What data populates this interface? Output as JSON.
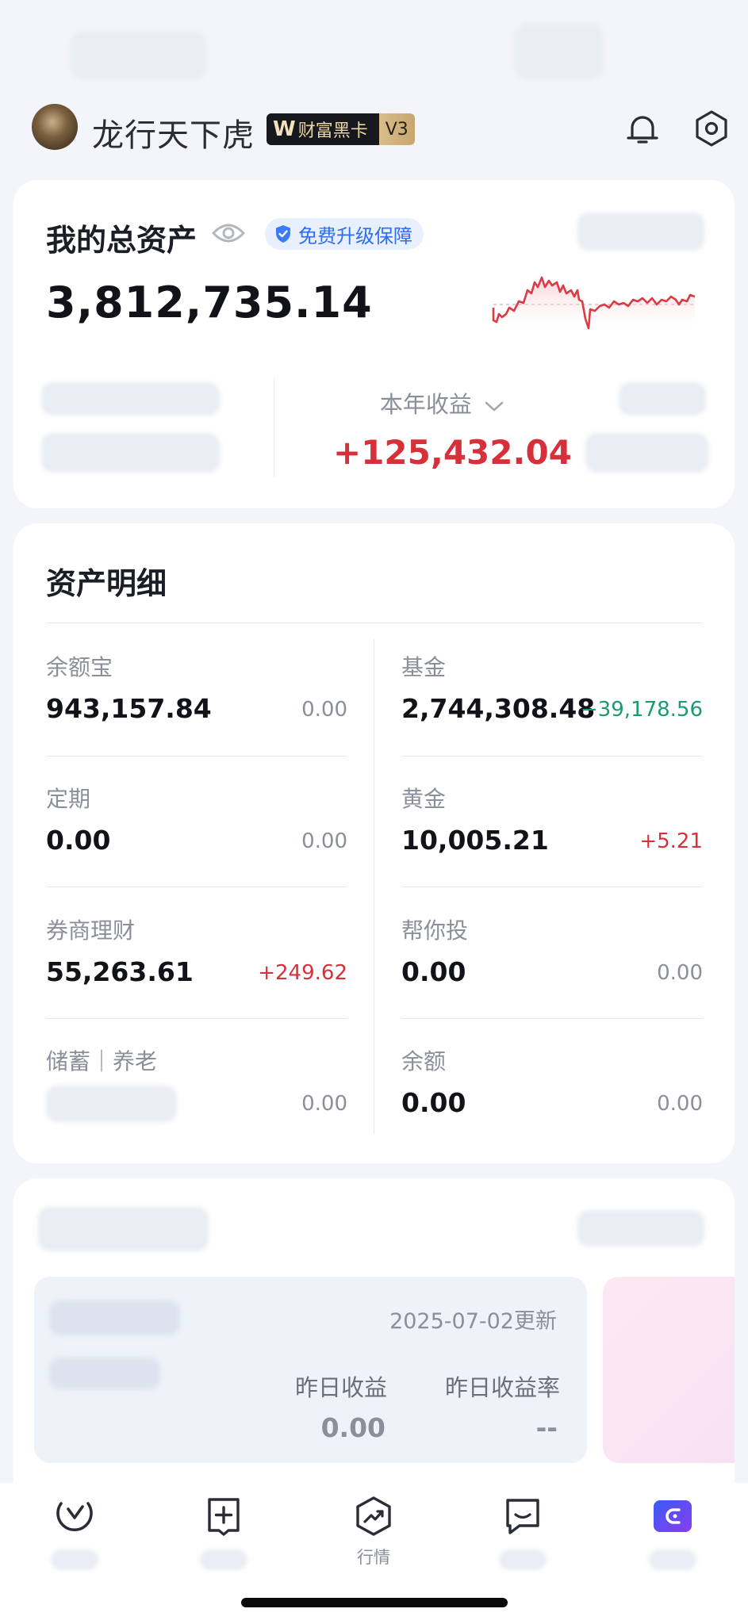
{
  "header": {
    "username": "龙行天下虎",
    "badge_brand": "W",
    "badge_label": "财富黑卡",
    "badge_level": "V3",
    "bell_icon": "bell-icon",
    "settings_icon": "settings-icon"
  },
  "total": {
    "title": "我的总资产",
    "protect_label": "免费升级保障",
    "value": "3,812,735.14",
    "year_label": "本年收益",
    "year_value": "+125,432.04"
  },
  "details": {
    "title": "资产明细",
    "left": [
      {
        "label": "余额宝",
        "value": "943,157.84",
        "change": "0.00"
      },
      {
        "label": "定期",
        "value": "0.00",
        "change": "0.00"
      },
      {
        "label": "券商理财",
        "value": "55,263.61",
        "change": "+249.62"
      },
      {
        "label": "储蓄｜养老",
        "value": "",
        "change": "0.00"
      }
    ],
    "right": [
      {
        "label": "基金",
        "value": "2,744,308.48",
        "change": "−39,178.56"
      },
      {
        "label": "黄金",
        "value": "10,005.21",
        "change": "+5.21"
      },
      {
        "label": "帮你投",
        "value": "0.00",
        "change": "0.00"
      },
      {
        "label": "余额",
        "value": "0.00",
        "change": "0.00"
      }
    ]
  },
  "update": {
    "date": "2025-07-02更新",
    "yesterday_label": "昨日收益",
    "yesterday_value": "0.00",
    "rate_label": "昨日收益率",
    "rate_value": "--"
  },
  "nav": {
    "items": [
      {
        "icon": "clock-icon",
        "label": ""
      },
      {
        "icon": "add-square-icon",
        "label": ""
      },
      {
        "icon": "trend-icon",
        "label": "行情"
      },
      {
        "icon": "message-icon",
        "label": ""
      },
      {
        "icon": "wallet-icon",
        "label": ""
      }
    ]
  },
  "colors": {
    "positive": "#d6303a",
    "negative": "#1d9a73",
    "accent": "#2d6df0",
    "wallet_gradient": [
      "#3a5cf5",
      "#8a3cf0"
    ]
  }
}
